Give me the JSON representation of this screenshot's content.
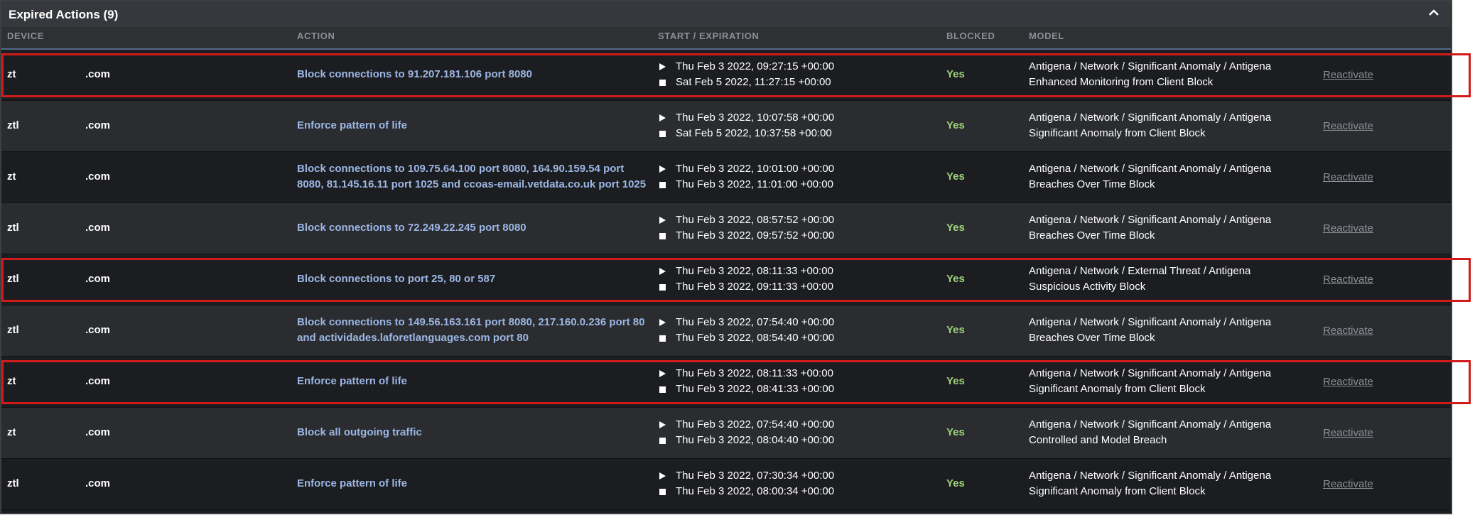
{
  "panel": {
    "title": "Expired Actions (9)",
    "collapse_icon": "chevron-up-icon"
  },
  "columns": [
    "DEVICE",
    "ACTION",
    "START / EXPIRATION",
    "BLOCKED",
    "MODEL"
  ],
  "rows": [
    {
      "device_prefix": "zt",
      "device_suffix": ".com",
      "action_lines": [
        "Block connections to 91.207.181.106 port 8080"
      ],
      "start": "Thu Feb 3 2022, 09:27:15 +00:00",
      "expiration": "Sat Feb 5 2022, 11:27:15 +00:00",
      "blocked": "Yes",
      "model_lines": [
        "Antigena / Network / Significant Anomaly / Antigena",
        "Enhanced Monitoring from Client Block"
      ],
      "link": "Reactivate",
      "highlighted": true
    },
    {
      "device_prefix": "ztl",
      "device_suffix": ".com",
      "action_lines": [
        "Enforce pattern of life"
      ],
      "start": "Thu Feb 3 2022, 10:07:58 +00:00",
      "expiration": "Sat Feb 5 2022, 10:37:58 +00:00",
      "blocked": "Yes",
      "model_lines": [
        "Antigena / Network / Significant Anomaly / Antigena",
        "Significant Anomaly from Client Block"
      ],
      "link": "Reactivate",
      "highlighted": false
    },
    {
      "device_prefix": "zt",
      "device_suffix": ".com",
      "action_lines": [
        "Block connections to 109.75.64.100 port 8080, 164.90.159.54 port",
        "8080, 81.145.16.11 port 1025 and ccoas-email.vetdata.co.uk port 1025"
      ],
      "start": "Thu Feb 3 2022, 10:01:00 +00:00",
      "expiration": "Thu Feb 3 2022, 11:01:00 +00:00",
      "blocked": "Yes",
      "model_lines": [
        "Antigena / Network / Significant Anomaly / Antigena",
        "Breaches Over Time Block"
      ],
      "link": "Reactivate",
      "highlighted": false
    },
    {
      "device_prefix": "ztl",
      "device_suffix": ".com",
      "action_lines": [
        "Block connections to 72.249.22.245 port 8080"
      ],
      "start": "Thu Feb 3 2022, 08:57:52 +00:00",
      "expiration": "Thu Feb 3 2022, 09:57:52 +00:00",
      "blocked": "Yes",
      "model_lines": [
        "Antigena / Network / Significant Anomaly / Antigena",
        "Breaches Over Time Block"
      ],
      "link": "Reactivate",
      "highlighted": false
    },
    {
      "device_prefix": "ztl",
      "device_suffix": ".com",
      "action_lines": [
        "Block connections to port 25, 80 or 587"
      ],
      "start": "Thu Feb 3 2022, 08:11:33 +00:00",
      "expiration": "Thu Feb 3 2022, 09:11:33 +00:00",
      "blocked": "Yes",
      "model_lines": [
        "Antigena / Network / External Threat / Antigena",
        "Suspicious Activity Block"
      ],
      "link": "Reactivate",
      "highlighted": true
    },
    {
      "device_prefix": "ztl",
      "device_suffix": ".com",
      "action_lines": [
        "Block connections to 149.56.163.161 port 8080, 217.160.0.236 port 80",
        "and actividades.laforetlanguages.com port 80"
      ],
      "start": "Thu Feb 3 2022, 07:54:40 +00:00",
      "expiration": "Thu Feb 3 2022, 08:54:40 +00:00",
      "blocked": "Yes",
      "model_lines": [
        "Antigena / Network / Significant Anomaly / Antigena",
        "Breaches Over Time Block"
      ],
      "link": "Reactivate",
      "highlighted": false
    },
    {
      "device_prefix": "zt",
      "device_suffix": ".com",
      "action_lines": [
        "Enforce pattern of life"
      ],
      "start": "Thu Feb 3 2022, 08:11:33 +00:00",
      "expiration": "Thu Feb 3 2022, 08:41:33 +00:00",
      "blocked": "Yes",
      "model_lines": [
        "Antigena / Network / Significant Anomaly / Antigena",
        "Significant Anomaly from Client Block"
      ],
      "link": "Reactivate",
      "highlighted": true
    },
    {
      "device_prefix": "zt",
      "device_suffix": ".com",
      "action_lines": [
        "Block all outgoing traffic"
      ],
      "start": "Thu Feb 3 2022, 07:54:40 +00:00",
      "expiration": "Thu Feb 3 2022, 08:04:40 +00:00",
      "blocked": "Yes",
      "model_lines": [
        "Antigena / Network / Significant Anomaly / Antigena",
        "Controlled and Model Breach"
      ],
      "link": "Reactivate",
      "highlighted": false
    },
    {
      "device_prefix": "ztl",
      "device_suffix": ".com",
      "action_lines": [
        "Enforce pattern of life"
      ],
      "start": "Thu Feb 3 2022, 07:30:34 +00:00",
      "expiration": "Thu Feb 3 2022, 08:00:34 +00:00",
      "blocked": "Yes",
      "model_lines": [
        "Antigena / Network / Significant Anomaly / Antigena",
        "Significant Anomaly from Client Block"
      ],
      "link": "Reactivate",
      "highlighted": false
    }
  ],
  "colors": {
    "action_link": "#9cb6e4",
    "blocked_yes": "#9fd27a",
    "highlight_box": "#d11b1b"
  }
}
